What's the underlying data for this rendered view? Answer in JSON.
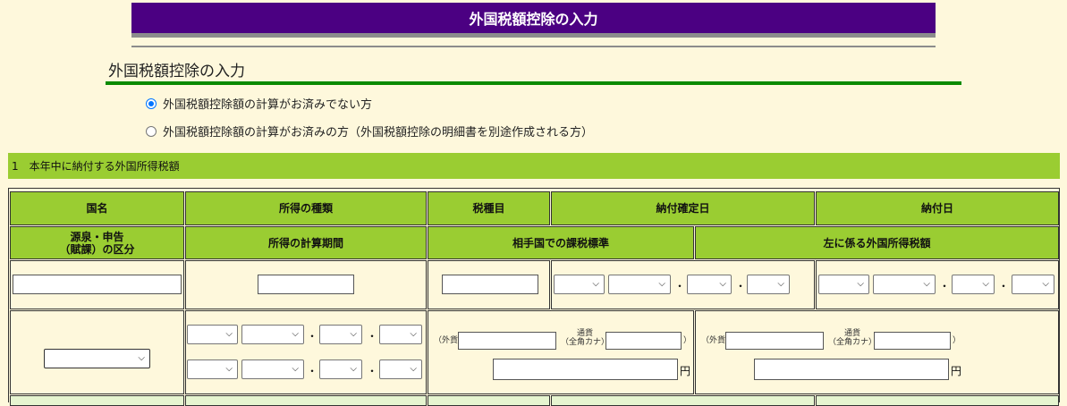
{
  "header": {
    "title": "外国税額控除の入力"
  },
  "section": {
    "title": "外国税額控除の入力"
  },
  "options": [
    {
      "label": "外国税額控除額の計算がお済みでない方",
      "selected": true
    },
    {
      "label": "外国税額控除額の計算がお済みの方（外国税額控除の明細書を別途作成される方）",
      "selected": false
    }
  ],
  "subsection": {
    "label": "1　本年中に納付する外国所得税額"
  },
  "table": {
    "headers_row1": [
      "国名",
      "所得の種類",
      "税種目",
      "納付確定日",
      "納付日"
    ],
    "headers_row2": [
      "源泉・申告\n（賦課）の区分",
      "所得の計算期間",
      "相手国での課税標準",
      "左に係る外国所得税額"
    ]
  },
  "currency": {
    "foreign_label": "（外貨",
    "currency_label_line1": "通貨",
    "currency_label_line2": "（全角カナ）",
    "close_paren": "）",
    "yen": "円"
  },
  "separator": "・"
}
